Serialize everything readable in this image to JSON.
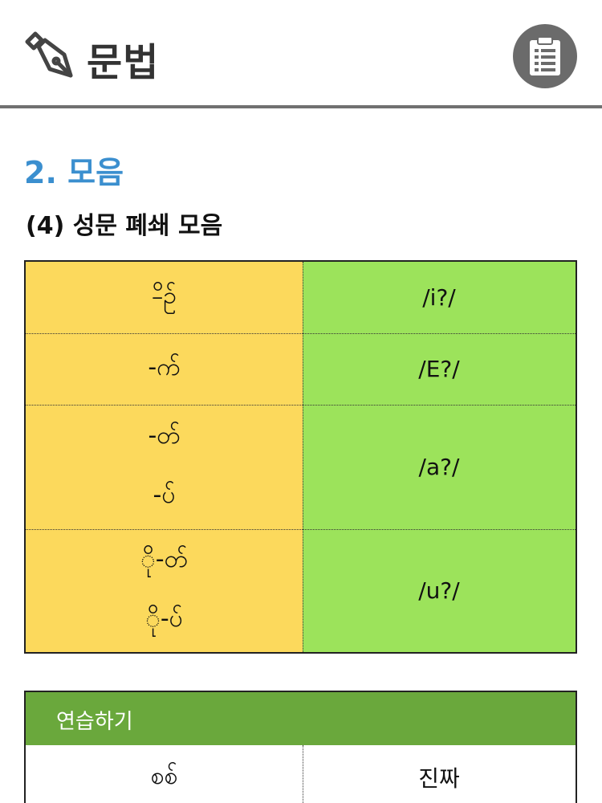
{
  "header": {
    "title": "문법",
    "title_icon": "fountain-pen-icon",
    "action_icon": "clipboard-icon"
  },
  "section": {
    "title": "2. 모음",
    "subtitle": "(4) 성문 폐쇄 모음"
  },
  "vowel_table": {
    "rows": [
      {
        "scripts": [
          "-ိဉ်"
        ],
        "sound": "/i?/"
      },
      {
        "scripts": [
          "-က်"
        ],
        "sound": "/E?/"
      },
      {
        "scripts": [
          "-တ်",
          "-ပ်"
        ],
        "sound": "/a?/"
      },
      {
        "scripts": [
          "ို-တ်",
          "ို-ပ်"
        ],
        "sound": "/u?/"
      }
    ]
  },
  "practice": {
    "heading": "연습하기",
    "row": {
      "left": "စစ်",
      "right": "진짜"
    }
  },
  "colors": {
    "accent_blue": "#3b8fcf",
    "left_column": "#fcd95c",
    "right_column": "#9ce35b",
    "practice_header": "#6aa83c"
  }
}
